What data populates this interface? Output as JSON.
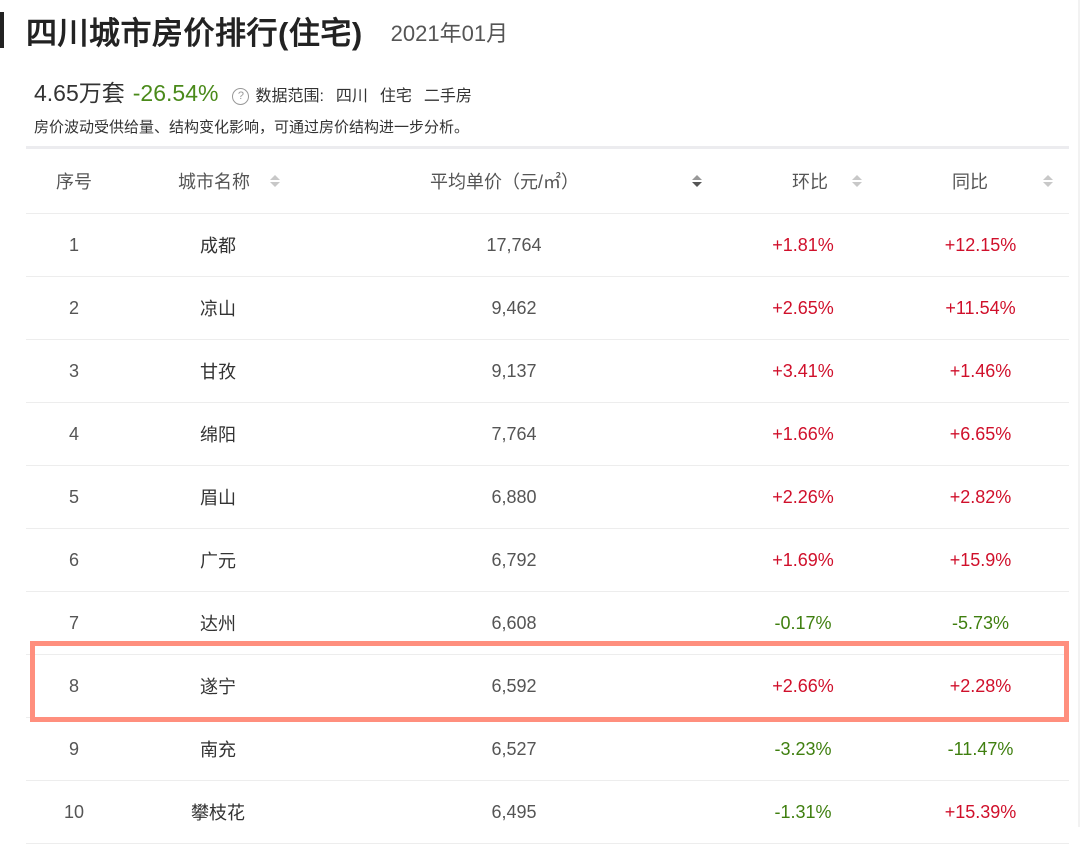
{
  "header": {
    "title": "四川城市房价排行(住宅)",
    "period": "2021年01月"
  },
  "summary": {
    "count": "4.65万套",
    "change": "-26.54%",
    "help_icon": "question-circle-icon",
    "scope_label": "数据范围:",
    "scope_items": [
      "四川",
      "住宅",
      "二手房"
    ],
    "note": "房价波动受供给量、结构变化影响，可通过房价结构进一步分析。"
  },
  "colors": {
    "up": "#d0102b",
    "down": "#3f7f0f",
    "highlight": "#ff8f7e"
  },
  "table": {
    "columns": [
      {
        "label": "序号",
        "sortable": false
      },
      {
        "label": "城市名称",
        "sortable": true
      },
      {
        "label": "平均单价（元/㎡）",
        "sortable": true,
        "sorted": "desc"
      },
      {
        "label": "环比",
        "sortable": true
      },
      {
        "label": "同比",
        "sortable": true
      }
    ],
    "rows": [
      {
        "idx": "1",
        "city": "成都",
        "price": "17,764",
        "mom": "+1.81%",
        "yoy": "+12.15%"
      },
      {
        "idx": "2",
        "city": "凉山",
        "price": "9,462",
        "mom": "+2.65%",
        "yoy": "+11.54%"
      },
      {
        "idx": "3",
        "city": "甘孜",
        "price": "9,137",
        "mom": "+3.41%",
        "yoy": "+1.46%"
      },
      {
        "idx": "4",
        "city": "绵阳",
        "price": "7,764",
        "mom": "+1.66%",
        "yoy": "+6.65%"
      },
      {
        "idx": "5",
        "city": "眉山",
        "price": "6,880",
        "mom": "+2.26%",
        "yoy": "+2.82%"
      },
      {
        "idx": "6",
        "city": "广元",
        "price": "6,792",
        "mom": "+1.69%",
        "yoy": "+15.9%"
      },
      {
        "idx": "7",
        "city": "达州",
        "price": "6,608",
        "mom": "-0.17%",
        "yoy": "-5.73%"
      },
      {
        "idx": "8",
        "city": "遂宁",
        "price": "6,592",
        "mom": "+2.66%",
        "yoy": "+2.28%",
        "highlighted": true
      },
      {
        "idx": "9",
        "city": "南充",
        "price": "6,527",
        "mom": "-3.23%",
        "yoy": "-11.47%"
      },
      {
        "idx": "10",
        "city": "攀枝花",
        "price": "6,495",
        "mom": "-1.31%",
        "yoy": "+15.39%"
      }
    ]
  }
}
